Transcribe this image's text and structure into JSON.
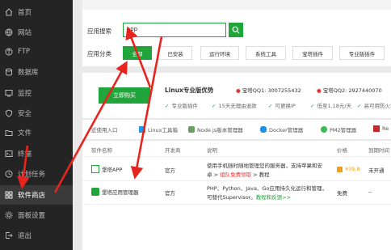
{
  "sidebar": {
    "items": [
      {
        "label": "首页",
        "icon": "home-icon"
      },
      {
        "label": "网站",
        "icon": "globe-icon"
      },
      {
        "label": "FTP",
        "icon": "ftp-icon"
      },
      {
        "label": "数据库",
        "icon": "database-icon"
      },
      {
        "label": "监控",
        "icon": "monitor-icon"
      },
      {
        "label": "安全",
        "icon": "shield-icon"
      },
      {
        "label": "文件",
        "icon": "folder-icon"
      },
      {
        "label": "终端",
        "icon": "terminal-icon"
      },
      {
        "label": "计划任务",
        "icon": "clock-icon"
      },
      {
        "label": "软件商店",
        "icon": "grid-icon"
      },
      {
        "label": "面板设置",
        "icon": "gear-icon"
      },
      {
        "label": "退出",
        "icon": "logout-icon"
      }
    ]
  },
  "search": {
    "label": "应用搜索",
    "value": "app",
    "category_label": "应用分类",
    "categories": [
      "全部",
      "已安装",
      "运行环境",
      "系统工具",
      "宝塔插件",
      "专业版插件"
    ],
    "selected_category": "全部"
  },
  "promo": {
    "buy_label": "立即购买",
    "title": "Linux专业版优势",
    "qq1": "宝塔QQ1: 3007255432",
    "qq2": "宝塔QQ2: 2927440070",
    "features": [
      "专业版插件",
      "15天无理由退款",
      "可更换IP",
      "低至1.18元/天",
      "高可用防火墙"
    ]
  },
  "tools": {
    "items": [
      "近使用入口",
      "Linux工具箱",
      "Node.js版本管理器",
      "Docker管理器",
      "PM2管理器",
      "Re"
    ]
  },
  "table": {
    "headers": [
      "软件名称",
      "开发商",
      "说明",
      "价格",
      "到期时间"
    ],
    "rows": [
      {
        "name": "堡塔APP",
        "vendor": "官方",
        "desc_line1": "使用手机随时随地管理您的服务器，支持苹果和安",
        "desc_line2_prefix": "卓 >",
        "desc_link_red": "组队免费领取",
        "desc_line2_suffix": "> 教程",
        "price": "¥39.8",
        "expire": "未开通"
      },
      {
        "name": "堡塔应用管理器",
        "vendor": "官方",
        "desc_line1": "PHP、Python、Java、Go应用持久化运行和管理，",
        "desc_line2_prefix": "可替代Supervisor。",
        "desc_link_green": "教程和反馈>>",
        "price": "免费",
        "expire": "--"
      }
    ]
  },
  "colors": {
    "accent": "#20a53a",
    "arrow": "#e8241e",
    "sidebar": "#242424",
    "price": "#f0a020"
  }
}
